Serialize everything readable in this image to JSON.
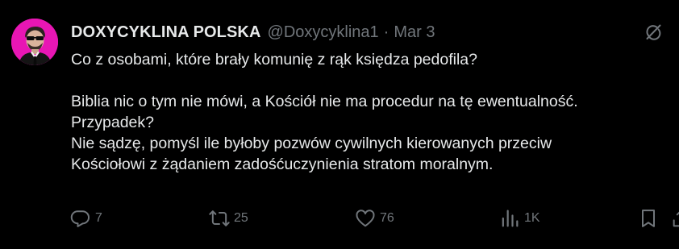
{
  "tweet": {
    "author": {
      "display_name": "DOXYCYKLINA POLSKA",
      "handle": "@Doxycyklina1",
      "avatar_bg": "#e816b4"
    },
    "separator": "·",
    "date": "Mar 3",
    "text_lines": [
      "Co z osobami, które brały komunię z rąk księdza pedofila?",
      "Biblia nic o tym nie mówi, a Kościół nie ma procedur na tę ewentualność.",
      "Przypadek?",
      "Nie sądzę, pomyśl ile byłoby pozwów cywilnych kierowanych przeciw",
      "Kościołowi z żądaniem zadośćuczynienia stratom moralnym."
    ],
    "actions": {
      "replies": "7",
      "reposts": "25",
      "likes": "76",
      "views": "1K"
    },
    "icons": {
      "grok": "grok-icon",
      "reply": "reply-icon",
      "repost": "repost-icon",
      "like": "heart-icon",
      "views": "views-icon",
      "bookmark": "bookmark-icon",
      "share": "share-icon"
    },
    "colors": {
      "text": "#e7e9ea",
      "muted": "#71767b",
      "background": "#000000"
    }
  }
}
